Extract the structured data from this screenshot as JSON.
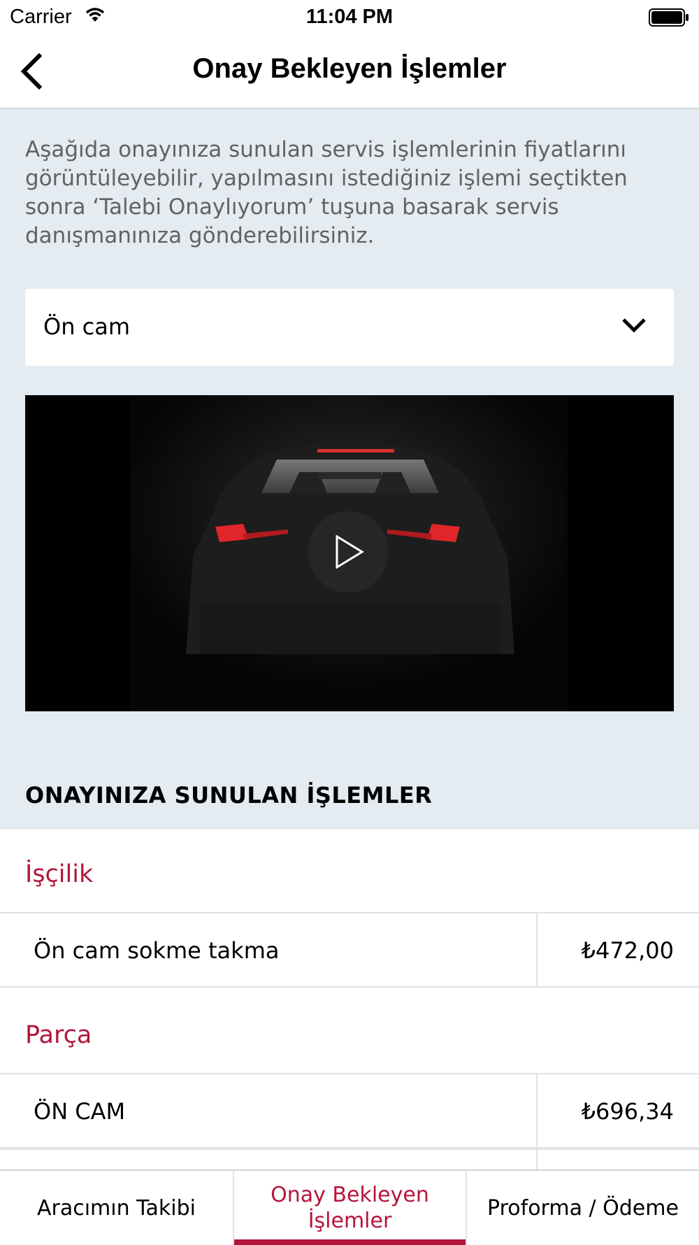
{
  "status_bar": {
    "carrier": "Carrier",
    "time": "11:04 PM"
  },
  "nav": {
    "title": "Onay Bekleyen İşlemler",
    "back_icon": "chevron-left-icon"
  },
  "intro_text": "Aşağıda onayınıza sunulan servis işlemlerinin fiyatlarını görüntüleyebilir, yapılmasını istediğiniz işlemi seçtikten sonra ‘Talebi Onaylıyorum’ tuşuna basarak servis danışmanınıza gönderebilirsiniz.",
  "dropdown": {
    "selected": "Ön cam"
  },
  "section_title": "ONAYINIZA SUNULAN İŞLEMLER",
  "groups": [
    {
      "title": "İşçilik",
      "items": [
        {
          "name": "Ön cam sokme takma",
          "price": "₺472,00"
        }
      ]
    },
    {
      "title": "Parça",
      "items": [
        {
          "name": "ÖN CAM",
          "price": "₺696,34"
        }
      ]
    }
  ],
  "tabs": [
    {
      "label": "Aracımın Takibi",
      "active": false
    },
    {
      "label": "Onay Bekleyen İşlemler",
      "active": true
    },
    {
      "label": "Proforma / Ödeme",
      "active": false
    }
  ],
  "colors": {
    "accent": "#b5153b",
    "background": "#e4ebf1"
  }
}
